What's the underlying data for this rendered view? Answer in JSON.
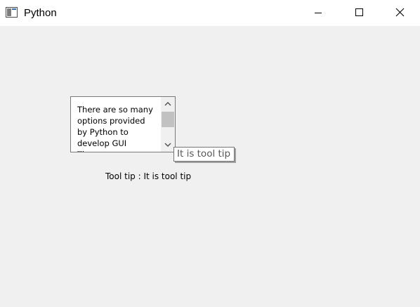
{
  "window": {
    "title": "Python",
    "icon": "python-window-icon",
    "controls": {
      "minimize": "minimize-icon",
      "maximize": "maximize-icon",
      "close": "close-icon"
    }
  },
  "textbox": {
    "content": "There are so many\noptions provided\nby Python to\ndevelop GUI\nTh"
  },
  "tooltip": {
    "text": "It is tool tip"
  },
  "status": {
    "text": "Tool tip : It is tool tip"
  }
}
